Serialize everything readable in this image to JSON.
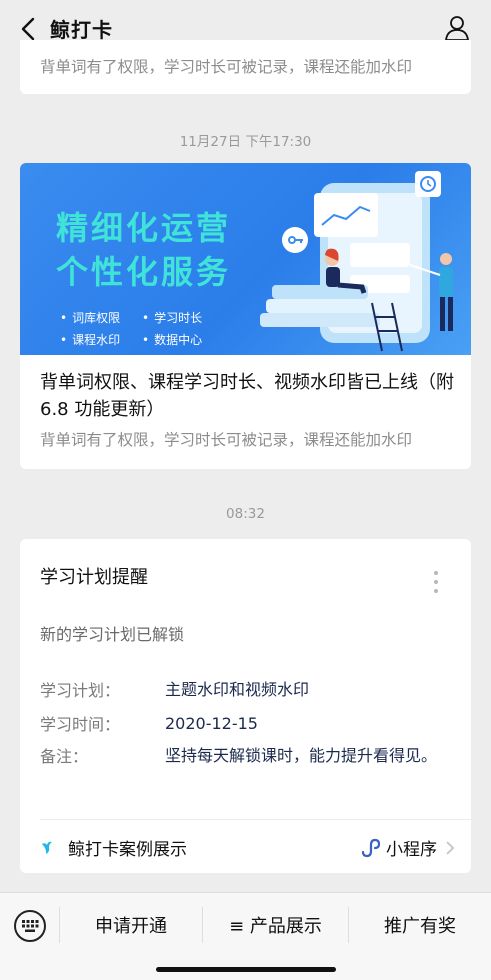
{
  "header": {
    "title": "鲸打卡"
  },
  "prev_card": {
    "summary": "背单词有了权限，学习时长可被记录，课程还能加水印"
  },
  "timestamps": [
    "11月27日 下午17:30",
    "08:32"
  ],
  "article": {
    "banner_line1": "精细化运营",
    "banner_line2": "个性化服务",
    "banner_features": [
      "词库权限",
      "学习时长",
      "课程水印",
      "数据中心"
    ],
    "title": "背单词权限、课程学习时长、视频水印皆已上线（附 6.8 功能更新）",
    "summary": "背单词有了权限，学习时长可被记录，课程还能加水印"
  },
  "notification": {
    "title": "学习计划提醒",
    "description": "新的学习计划已解锁",
    "fields": [
      {
        "label": "学习计划：",
        "value": "主题水印和视频水印"
      },
      {
        "label": "学习时间：",
        "value": "2020-12-15"
      },
      {
        "label": "备注：",
        "value": "坚持每天解锁课时，能力提升看得见。"
      }
    ],
    "source": "鲸打卡案例展示",
    "mini_program": "小程序"
  },
  "bottom_menu": {
    "items": [
      "申请开通",
      "≡ 产品展示",
      "推广有奖"
    ]
  },
  "colors": {
    "background": "#ededed",
    "banner": "#2b7de9",
    "banner_text": "#3fe3d8",
    "link_value": "#1c2a4d"
  },
  "icons": [
    "back-arrow-icon",
    "profile-icon",
    "more-dots-icon",
    "whale-icon",
    "mini-program-icon",
    "chevron-right-icon",
    "keyboard-icon"
  ]
}
